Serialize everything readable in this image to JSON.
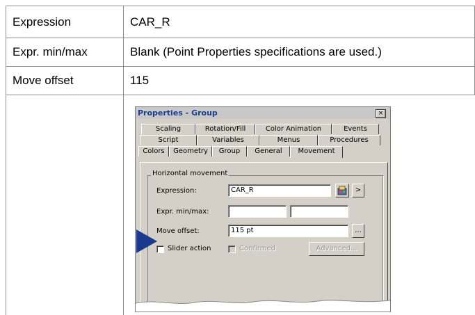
{
  "rows": [
    {
      "label": "Expression",
      "value": "CAR_R"
    },
    {
      "label": "Expr. min/max",
      "value": "Blank (Point Properties specifications are used.)"
    },
    {
      "label": "Move offset",
      "value": "115"
    },
    {
      "label": "",
      "value": ""
    }
  ],
  "dialog": {
    "title": "Properties - Group",
    "close_glyph": "×",
    "tab_rows": [
      [
        "Scaling",
        "Rotation/Fill",
        "Color Animation",
        "Events"
      ],
      [
        "Script",
        "Variables",
        "Menus",
        "Procedures"
      ],
      [
        "Colors",
        "Geometry",
        "Group",
        "General",
        "Movement"
      ]
    ],
    "active_tab": "Movement",
    "group_title": "Horizontal movement",
    "expression_label": "Expression:",
    "expression_value": "CAR_R",
    "expr_minmax_label": "Expr. min/max:",
    "expr_min_value": "",
    "expr_max_value": "",
    "move_offset_label": "Move offset:",
    "move_offset_value": "115 pt",
    "ellipsis_label": "...",
    "arrow_button_label": ">",
    "slider_action_label": "Slider action",
    "confirmed_label": "Confirmed",
    "advanced_label": "Advanced...",
    "accent_color": "#1a3a8e"
  }
}
